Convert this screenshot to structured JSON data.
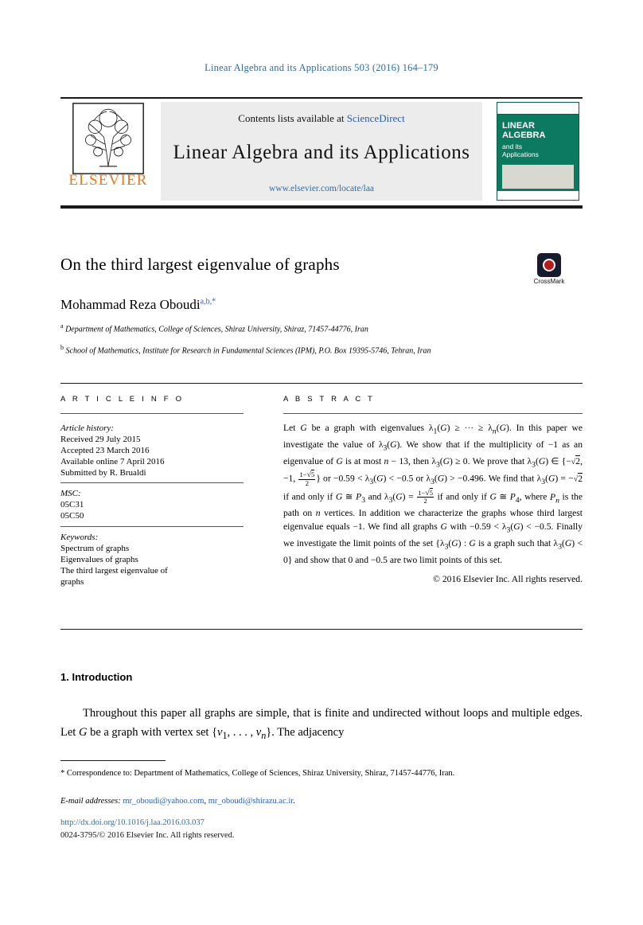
{
  "running_head": "Linear Algebra and its Applications 503 (2016) 164–179",
  "masthead": {
    "contents_prefix": "Contents lists available at",
    "contents_link": "ScienceDirect",
    "journal_title": "Linear Algebra and its Applications",
    "journal_url": "www.elsevier.com/locate/laa",
    "publisher": "ELSEVIER",
    "cover": {
      "line1": "LINEAR",
      "line2": "ALGEBRA",
      "line3": "and its",
      "line4": "Applications"
    }
  },
  "article": {
    "title": "On the third largest eigenvalue of graphs",
    "author": "Mohammad Reza Oboudi",
    "author_sup": "a,b,*",
    "affiliations": [
      {
        "sup": "a",
        "text": "Department of Mathematics, College of Sciences, Shiraz University, Shiraz, 71457-44776, Iran"
      },
      {
        "sup": "b",
        "text": "School of Mathematics, Institute for Research in Fundamental Sciences (IPM), P.O. Box 19395-5746, Tehran, Iran"
      }
    ],
    "crossmark_label": "CrossMark"
  },
  "info": {
    "heading": "A R T I C L E   I N F O",
    "history_label": "Article history:",
    "history": [
      "Received 29 July 2015",
      "Accepted 23 March 2016",
      "Available online 7 April 2016",
      "Submitted by R. Brualdi"
    ],
    "msc_label": "MSC:",
    "msc": [
      "05C31",
      "05C50"
    ],
    "keywords_label": "Keywords:",
    "keywords": [
      "Spectrum of graphs",
      "Eigenvalues of graphs",
      "The third largest eigenvalue of",
      "graphs"
    ]
  },
  "abstract": {
    "heading": "A B S T R A C T",
    "copyright": "© 2016 Elsevier Inc. All rights reserved."
  },
  "body": {
    "section_number": "1.",
    "section_title": "Introduction"
  },
  "footnotes": {
    "correspondence": "* Correspondence to: Department of Mathematics, College of Sciences, Shiraz University, Shiraz, 71457-44776, Iran.",
    "email_label": "E-mail addresses:",
    "email1": "mr_oboudi@yahoo.com",
    "email_sep": ",",
    "email2": "mr_oboudi@shirazu.ac.ir",
    "email_end": ".",
    "doi": "http://dx.doi.org/10.1016/j.laa.2016.03.037",
    "issn": "0024-3795/© 2016 Elsevier Inc. All rights reserved."
  },
  "colors": {
    "link": "#2e6da4",
    "elsevier_orange": "#e87722",
    "cover_green": "#0b7a60"
  }
}
